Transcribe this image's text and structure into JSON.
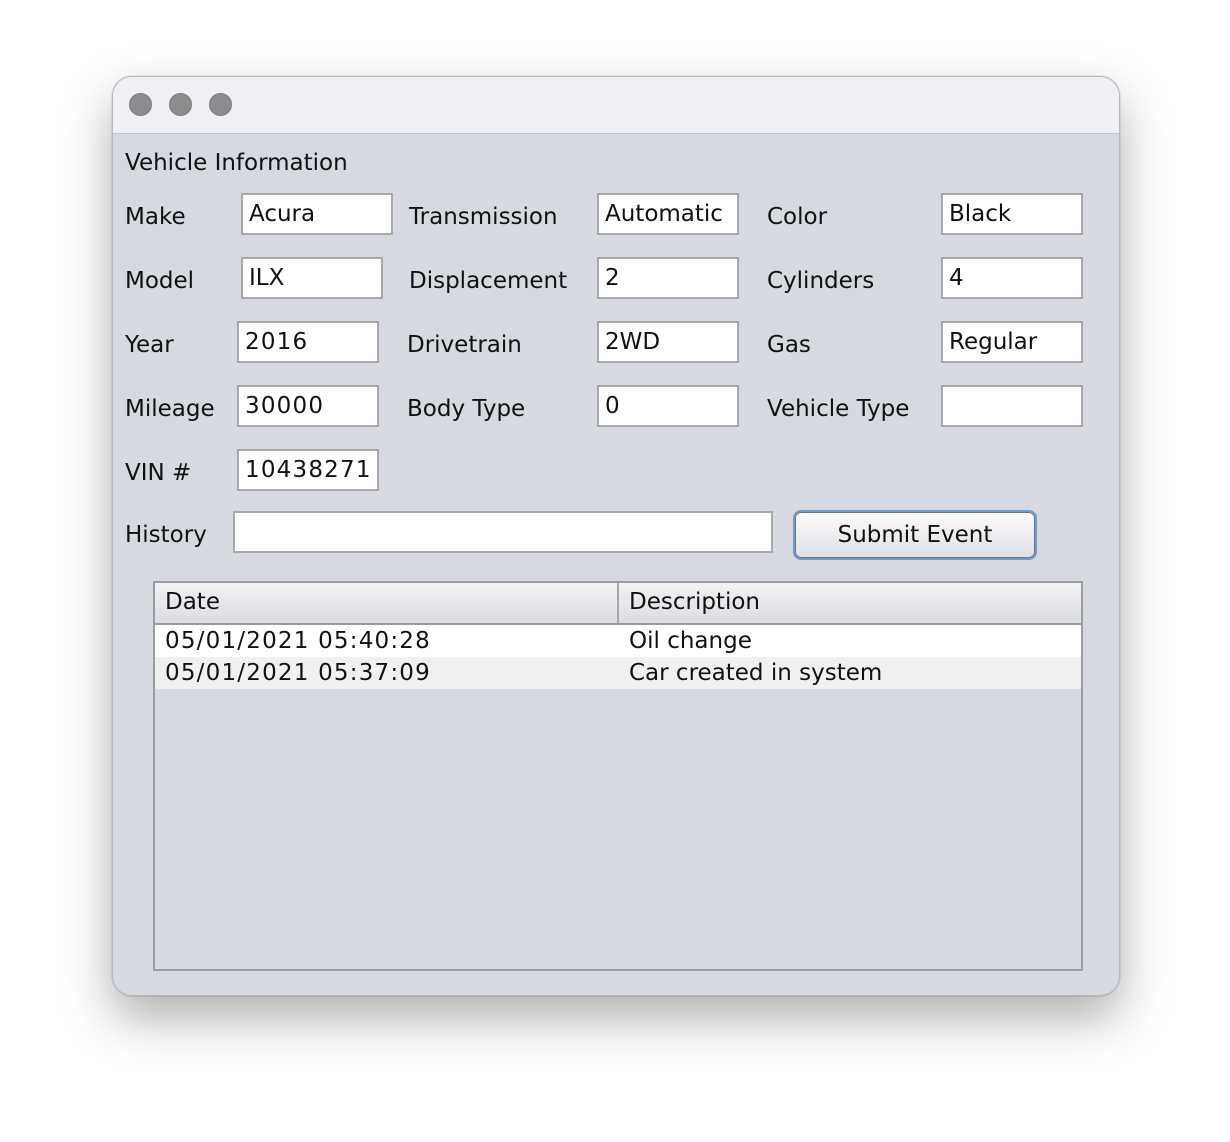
{
  "window": {
    "controls": [
      "close",
      "minimize",
      "zoom"
    ]
  },
  "section_title": "Vehicle Information",
  "fields": {
    "make": {
      "label": "Make",
      "value": "Acura"
    },
    "transmission": {
      "label": "Transmission",
      "value": "Automatic"
    },
    "color": {
      "label": "Color",
      "value": "Black"
    },
    "model": {
      "label": "Model",
      "value": "ILX"
    },
    "displacement": {
      "label": "Displacement",
      "value": "2"
    },
    "cylinders": {
      "label": "Cylinders",
      "value": "4"
    },
    "year": {
      "label": "Year",
      "value": "2016"
    },
    "drivetrain": {
      "label": "Drivetrain",
      "value": "2WD"
    },
    "gas": {
      "label": "Gas",
      "value": "Regular"
    },
    "mileage": {
      "label": "Mileage",
      "value": "30000"
    },
    "body_type": {
      "label": "Body Type",
      "value": "0"
    },
    "vehicle_type": {
      "label": "Vehicle Type",
      "value": ""
    },
    "vin": {
      "label": "VIN #",
      "value": "10438271"
    },
    "history": {
      "label": "History",
      "value": ""
    }
  },
  "submit_button": "Submit Event",
  "table": {
    "columns": [
      "Date",
      "Description"
    ],
    "rows": [
      {
        "date": "05/01/2021 05:40:28",
        "description": "Oil change"
      },
      {
        "date": "05/01/2021 05:37:09",
        "description": "Car created in system"
      }
    ]
  }
}
